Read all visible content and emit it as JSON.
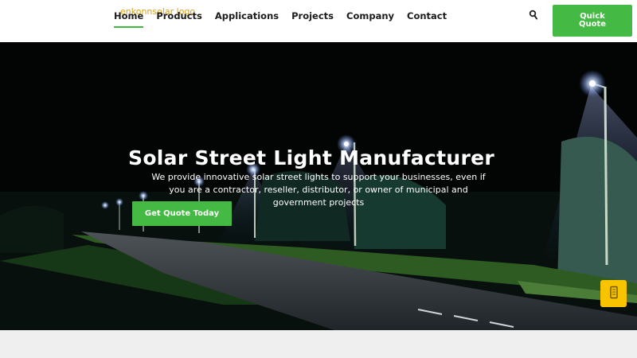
{
  "header": {
    "logo_alt": "enkonnsolar logo",
    "nav": [
      {
        "label": "Home",
        "active": true
      },
      {
        "label": "Products",
        "active": false
      },
      {
        "label": "Applications",
        "active": false
      },
      {
        "label": "Projects",
        "active": false
      },
      {
        "label": "Company",
        "active": false
      },
      {
        "label": "Contact",
        "active": false
      }
    ],
    "search_icon": "search-icon",
    "quote_button": "Quick Quote"
  },
  "hero": {
    "title": "Solar Street Light Manufacturer",
    "subtitle": "We provide innovative solar street lights to support your businesses, even if you are a contractor, reseller, distributor, or owner of municipal and government projects",
    "cta": "Get Quote Today",
    "floating_icon": "phone-icon"
  },
  "colors": {
    "accent_green": "#44b944",
    "floating_yellow": "#f8c400",
    "header_bg": "#ffffff",
    "hero_bg": "#020403",
    "below_bg": "#efefef"
  }
}
